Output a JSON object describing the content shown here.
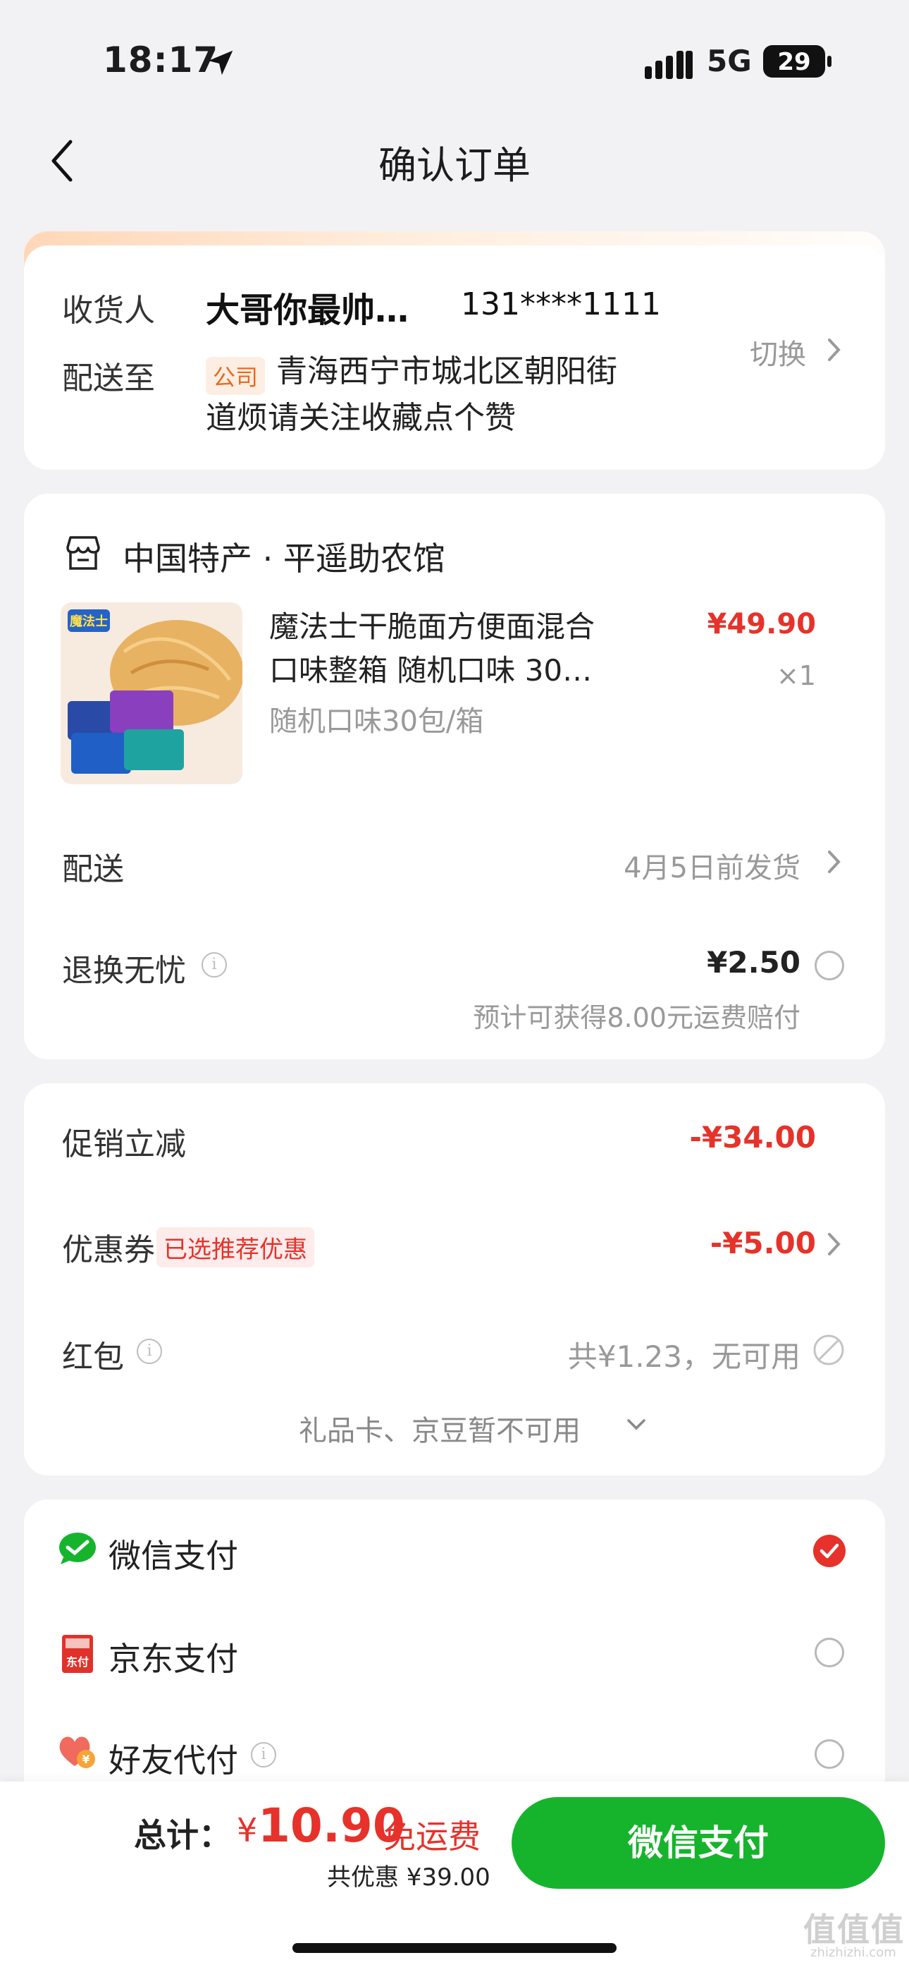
{
  "status": {
    "time": "18:17",
    "network": "5G",
    "battery": "29"
  },
  "nav": {
    "title": "确认订单"
  },
  "address": {
    "receiver_label": "收货人",
    "receiver_name": "大哥你最帅…",
    "phone": "131****1111",
    "deliver_label": "配送至",
    "tag": "公司",
    "line1": "青海西宁市城北区朝阳街",
    "line2": "道烦请关注收藏点个赞",
    "switch_label": "切换"
  },
  "shop": {
    "name": "中国特产 · 平遥助农馆",
    "product": {
      "title_line1": "魔法士干脆面方便面混合",
      "title_line2": "口味整箱 随机口味 30…",
      "sku": "随机口味30包/箱",
      "price": "¥49.90",
      "qty": "×1"
    },
    "delivery_label": "配送",
    "delivery_value": "4月5日前发货",
    "return_label": "退换无忧",
    "return_price": "¥2.50",
    "return_note": "预计可获得8.00元运费赔付"
  },
  "discounts": {
    "promo_label": "促销立减",
    "promo_value": "-¥34.00",
    "coupon_label": "优惠券",
    "coupon_tag": "已选推荐优惠",
    "coupon_value": "-¥5.00",
    "redpacket_label": "红包",
    "redpacket_value": "共¥1.23，无可用",
    "more_label": "礼品卡、京豆暂不可用"
  },
  "payment": {
    "options": [
      {
        "label": "微信支付"
      },
      {
        "label": "京东支付"
      },
      {
        "label": "好友代付"
      }
    ]
  },
  "footer": {
    "total_label": "总计：",
    "currency": "¥",
    "total": "10.90",
    "free_shipping": "免运费",
    "saved": "共优惠 ¥39.00",
    "pay_button": "微信支付"
  },
  "watermark": {
    "main": "值值值",
    "sub": "zhizhizhi.com"
  },
  "colors": {
    "accent_red": "#e6322a",
    "wechat_green": "#16b42c",
    "company_tag": "#e86a1f"
  }
}
